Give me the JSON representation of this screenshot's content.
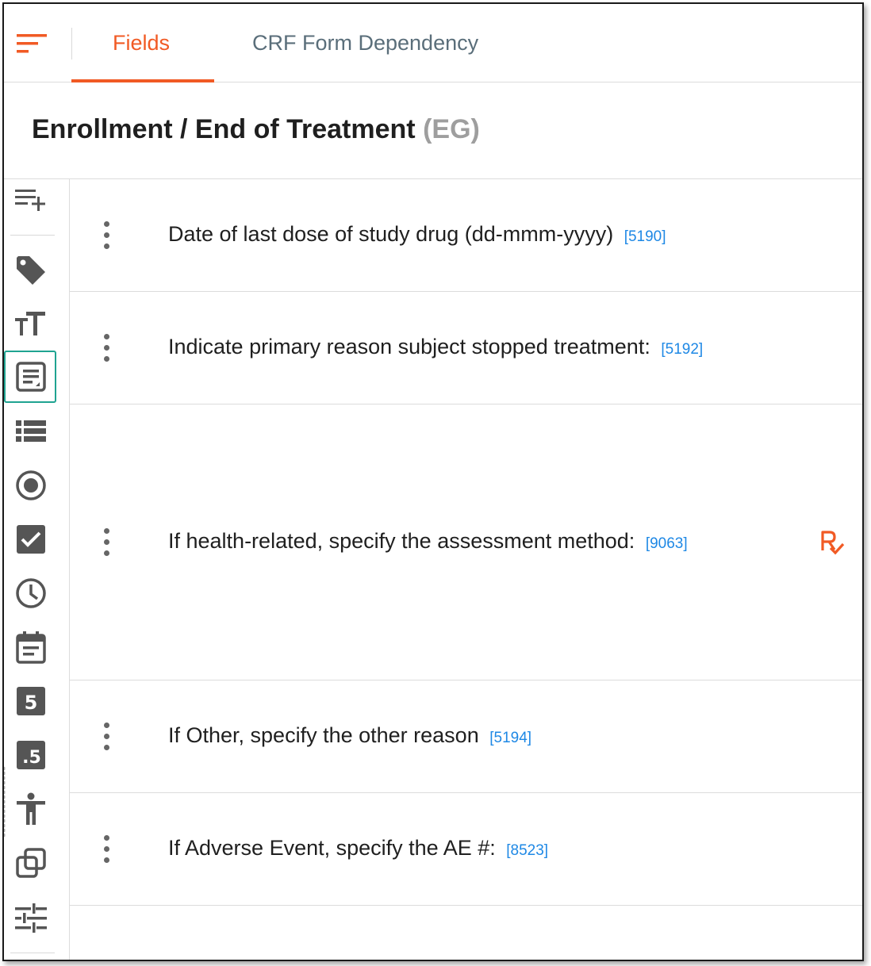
{
  "tabs": {
    "fields_label": "Fields",
    "crf_label": "CRF Form Dependency",
    "active": "Fields"
  },
  "form": {
    "title": "Enrollment / End of Treatment",
    "code": "(EG)"
  },
  "toolbar": {
    "items": [
      "add-field-icon",
      "tag-icon",
      "text-size-icon",
      "text-area-icon",
      "list-icon",
      "radio-button-icon",
      "checkbox-icon",
      "clock-icon",
      "calendar-icon",
      "integer-icon",
      "decimal-icon",
      "accessibility-icon",
      "copy-icon",
      "tune-icon"
    ],
    "selected": "text-area-icon"
  },
  "fields": [
    {
      "label": "Date of last dose of study drug (dd-mmm-yyyy)",
      "id": "[5190]",
      "has_rule": false
    },
    {
      "label": "Indicate primary reason subject stopped treatment:",
      "id": "[5192]",
      "has_rule": false
    },
    {
      "label": "If health-related, specify the assessment method:",
      "id": "[9063]",
      "has_rule": true
    },
    {
      "label": "If Other, specify the other reason",
      "id": "[5194]",
      "has_rule": false
    },
    {
      "label": "If Adverse Event, specify the AE #:",
      "id": "[8523]",
      "has_rule": false
    }
  ],
  "colors": {
    "accent": "#f15a24",
    "id_link": "#1e88e5",
    "selected_outline": "#1fa391",
    "icon": "#555555"
  }
}
